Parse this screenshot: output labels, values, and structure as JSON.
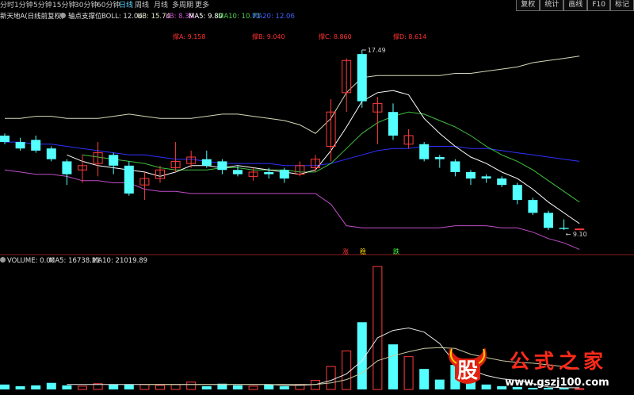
{
  "toolbar": {
    "timeframes": [
      {
        "label": "分时",
        "active": false
      },
      {
        "label": "1分钟",
        "active": false
      },
      {
        "label": "5分钟",
        "active": false
      },
      {
        "label": "15分钟",
        "active": false
      },
      {
        "label": "30分钟",
        "active": false
      },
      {
        "label": "60分钟",
        "active": false
      },
      {
        "label": "日线",
        "active": true
      },
      {
        "label": "周线",
        "active": false
      },
      {
        "label": "月线",
        "active": false
      },
      {
        "label": "多周期",
        "active": false
      },
      {
        "label": "更多",
        "active": false
      }
    ],
    "right_buttons": [
      "复权",
      "统计",
      "画线",
      "F10",
      "标记"
    ]
  },
  "info_bar": {
    "stock": "新天地A(日线前复权)",
    "indicator": "轴点支撑位",
    "boll": "BOLL: 12.06",
    "ub": "UB: 15.74",
    "lb": "LB: 8.39",
    "ma5": "MA5: 9.80",
    "ma10": "MA10: 10.71",
    "ma20": "MA20: 12.06"
  },
  "support_labels": [
    {
      "name": "撑A:",
      "value": "9.158"
    },
    {
      "name": "撑B:",
      "value": "9.040"
    },
    {
      "name": "撑C:",
      "value": "8.860"
    },
    {
      "name": "撑D:",
      "value": "8.614"
    }
  ],
  "price_annotations": {
    "high": "17.49",
    "low": "9.10"
  },
  "volume_info": {
    "volume": "VOLUME: 0.00",
    "ma5": "MA5: 16738.21",
    "ma10": "MA10: 21019.89"
  },
  "signals": [
    {
      "text": "涨",
      "color": "#ff3b3b"
    },
    {
      "text": "稳",
      "color": "#ffd700"
    },
    {
      "text": "跌",
      "color": "#40ff40"
    }
  ],
  "watermark": {
    "logo": "股",
    "title": "公式之家",
    "url": "www.gszj100.com"
  },
  "colors": {
    "up": "#ff3b3b",
    "down": "#54ffff",
    "ub": "#d6d6b8",
    "lb": "#c04ec8",
    "ma5": "#ffffff",
    "ma10": "#40c040",
    "ma20": "#3030ff"
  },
  "chart_data": {
    "type": "candlestick",
    "candles": [
      {
        "o": 13.5,
        "c": 13.2,
        "h": 13.6,
        "l": 13.1
      },
      {
        "o": 13.2,
        "c": 12.9,
        "h": 13.4,
        "l": 12.8
      },
      {
        "o": 13.3,
        "c": 12.8,
        "h": 13.5,
        "l": 12.7
      },
      {
        "o": 12.9,
        "c": 12.4,
        "h": 13.0,
        "l": 12.3
      },
      {
        "o": 12.3,
        "c": 11.7,
        "h": 12.4,
        "l": 11.2
      },
      {
        "o": 11.9,
        "c": 12.1,
        "h": 12.6,
        "l": 11.3
      },
      {
        "o": 12.2,
        "c": 12.7,
        "h": 13.2,
        "l": 11.6
      },
      {
        "o": 12.6,
        "c": 12.1,
        "h": 12.7,
        "l": 11.7
      },
      {
        "o": 12.1,
        "c": 10.8,
        "h": 12.3,
        "l": 10.7
      },
      {
        "o": 11.2,
        "c": 11.5,
        "h": 11.8,
        "l": 10.5
      },
      {
        "o": 11.5,
        "c": 11.9,
        "h": 12.1,
        "l": 11.3
      },
      {
        "o": 12.0,
        "c": 12.3,
        "h": 13.2,
        "l": 11.8
      },
      {
        "o": 12.2,
        "c": 12.5,
        "h": 12.8,
        "l": 12.0
      },
      {
        "o": 12.4,
        "c": 12.1,
        "h": 12.8,
        "l": 12.0
      },
      {
        "o": 12.3,
        "c": 11.9,
        "h": 12.4,
        "l": 11.7
      },
      {
        "o": 11.9,
        "c": 11.7,
        "h": 12.1,
        "l": 11.6
      },
      {
        "o": 11.6,
        "c": 11.8,
        "h": 12.0,
        "l": 11.4
      },
      {
        "o": 11.8,
        "c": 11.7,
        "h": 12.0,
        "l": 11.5
      },
      {
        "o": 11.9,
        "c": 11.5,
        "h": 12.0,
        "l": 11.3
      },
      {
        "o": 11.7,
        "c": 12.1,
        "h": 12.3,
        "l": 11.6
      },
      {
        "o": 12.0,
        "c": 12.4,
        "h": 12.6,
        "l": 11.8
      },
      {
        "o": 13.0,
        "c": 14.6,
        "h": 15.2,
        "l": 12.3
      },
      {
        "o": 15.5,
        "c": 17.0,
        "h": 17.1,
        "l": 14.6
      },
      {
        "o": 17.3,
        "c": 15.1,
        "h": 17.49,
        "l": 14.8
      },
      {
        "o": 14.6,
        "c": 15.0,
        "h": 15.3,
        "l": 13.1
      },
      {
        "o": 14.6,
        "c": 13.5,
        "h": 15.0,
        "l": 13.3
      },
      {
        "o": 13.1,
        "c": 13.5,
        "h": 13.8,
        "l": 12.9
      },
      {
        "o": 13.1,
        "c": 12.4,
        "h": 13.2,
        "l": 12.3
      },
      {
        "o": 12.5,
        "c": 12.4,
        "h": 12.6,
        "l": 12.0
      },
      {
        "o": 12.3,
        "c": 11.8,
        "h": 12.4,
        "l": 11.6
      },
      {
        "o": 11.8,
        "c": 11.5,
        "h": 11.9,
        "l": 11.2
      },
      {
        "o": 11.6,
        "c": 11.5,
        "h": 11.7,
        "l": 11.3
      },
      {
        "o": 11.5,
        "c": 11.2,
        "h": 11.6,
        "l": 11.1
      },
      {
        "o": 11.2,
        "c": 10.5,
        "h": 11.3,
        "l": 10.3
      },
      {
        "o": 10.5,
        "c": 9.9,
        "h": 10.6,
        "l": 9.8
      },
      {
        "o": 9.9,
        "c": 9.2,
        "h": 10.0,
        "l": 9.1
      },
      {
        "o": 9.2,
        "c": 9.15,
        "h": 9.6,
        "l": 9.1
      },
      {
        "o": 9.15,
        "c": 9.15,
        "h": 9.15,
        "l": 9.15
      }
    ],
    "ub": [
      14.3,
      14.3,
      14.4,
      14.4,
      14.3,
      14.3,
      14.3,
      14.4,
      14.5,
      14.4,
      14.3,
      14.3,
      14.3,
      14.4,
      14.5,
      14.5,
      14.4,
      14.3,
      14.2,
      14.0,
      13.6,
      14.3,
      15.5,
      16.2,
      16.3,
      16.3,
      16.3,
      16.3,
      16.3,
      16.4,
      16.4,
      16.5,
      16.6,
      16.7,
      16.9,
      17.0,
      17.1,
      17.2
    ],
    "lb": [
      11.9,
      11.8,
      11.7,
      11.7,
      11.6,
      11.4,
      11.4,
      11.3,
      11.3,
      11.0,
      10.9,
      10.9,
      10.8,
      10.8,
      10.8,
      10.8,
      10.8,
      10.8,
      10.8,
      10.8,
      10.8,
      10.3,
      9.3,
      9.2,
      9.2,
      9.2,
      9.2,
      9.2,
      9.2,
      9.3,
      9.3,
      9.3,
      9.2,
      9.2,
      9.0,
      8.7,
      8.5,
      8.2
    ],
    "ma20": [
      13.2,
      13.2,
      13.1,
      13.1,
      13.0,
      12.9,
      12.8,
      12.7,
      12.6,
      12.6,
      12.5,
      12.4,
      12.4,
      12.3,
      12.2,
      12.2,
      12.2,
      12.2,
      12.1,
      12.1,
      12.1,
      12.2,
      12.4,
      12.6,
      12.8,
      12.9,
      12.9,
      13.0,
      13.0,
      13.0,
      12.9,
      12.9,
      12.8,
      12.7,
      12.6,
      12.5,
      12.4,
      12.3
    ],
    "ma10": [
      null,
      null,
      null,
      null,
      null,
      12.6,
      12.5,
      12.4,
      12.3,
      12.2,
      12.0,
      11.9,
      11.9,
      11.9,
      12.0,
      12.0,
      11.9,
      11.9,
      11.9,
      11.8,
      11.8,
      12.2,
      12.9,
      13.6,
      14.1,
      14.4,
      14.6,
      14.5,
      14.2,
      13.9,
      13.5,
      13.0,
      12.6,
      12.3,
      11.9,
      11.4,
      10.9,
      10.4
    ],
    "ma5": [
      null,
      null,
      null,
      null,
      12.6,
      12.3,
      12.1,
      12.0,
      11.9,
      11.8,
      11.6,
      11.8,
      12.1,
      12.1,
      12.0,
      12.1,
      12.0,
      11.9,
      11.8,
      11.7,
      11.9,
      12.8,
      13.9,
      15.1,
      15.5,
      15.6,
      15.4,
      14.3,
      13.6,
      13.0,
      12.5,
      12.2,
      11.8,
      11.5,
      11.0,
      10.4,
      9.9,
      9.4
    ],
    "volume": [
      6,
      4,
      5,
      8,
      5,
      4,
      7,
      6,
      6,
      6,
      5,
      6,
      9,
      4,
      7,
      5,
      4,
      6,
      4,
      6,
      11,
      28,
      47,
      82,
      150,
      55,
      40,
      25,
      12,
      30,
      12,
      6,
      4,
      3,
      2,
      2,
      2,
      1
    ],
    "vol_ma5": [
      null,
      null,
      null,
      null,
      6,
      6,
      6,
      6,
      6,
      6,
      6,
      6,
      6,
      6,
      6,
      6,
      6,
      6,
      5,
      5,
      6,
      11,
      19,
      35,
      63,
      72,
      75,
      70,
      56,
      32,
      24,
      17,
      13,
      11,
      7,
      3,
      2,
      2
    ],
    "vol_ma10": [
      null,
      null,
      null,
      null,
      null,
      null,
      null,
      null,
      null,
      6,
      6,
      6,
      6,
      6,
      6,
      6,
      6,
      6,
      6,
      6,
      6,
      8,
      12,
      20,
      35,
      41,
      46,
      50,
      51,
      50,
      43,
      39,
      35,
      33,
      32,
      30,
      28,
      25
    ]
  }
}
